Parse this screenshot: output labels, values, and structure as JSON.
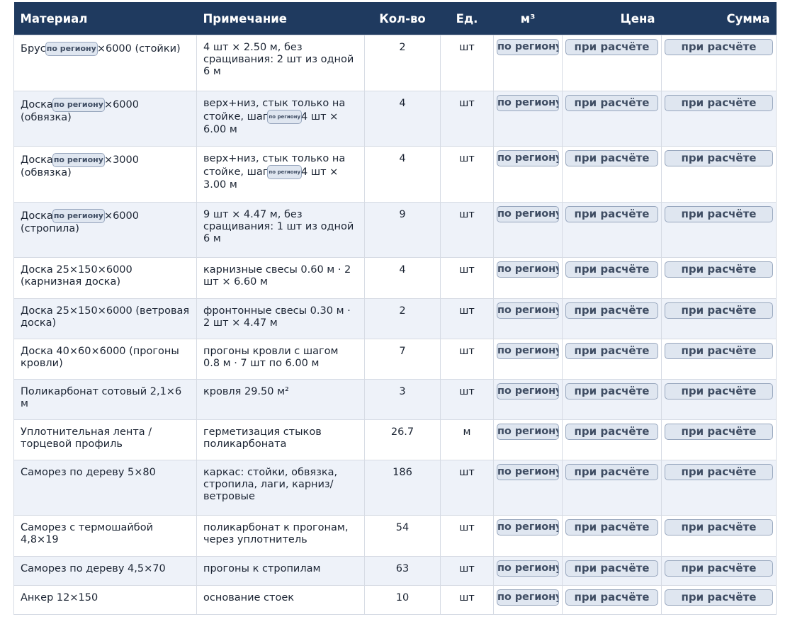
{
  "headers": {
    "material": "Материал",
    "note": "Примечание",
    "qty": "Кол-во",
    "unit": "Ед.",
    "m3": "м³",
    "price": "Цена",
    "sum": "Сумма"
  },
  "placeholders": {
    "region": "по региону",
    "calc": "при расчёте"
  },
  "rows": [
    {
      "mat_a": "Брус",
      "mat_b": "×6000 (стойки)",
      "note": "4 шт × 2.50 м, без сращивания: 2 шт из одной 6 м",
      "qty": "2",
      "unit": "шт"
    },
    {
      "mat_a": "Доска",
      "mat_b": "×6000 (обвязка)",
      "note_a": "верх+низ, стык только на стойке, шаг",
      "note_b": "4 шт × 6.00 м",
      "qty": "4",
      "unit": "шт"
    },
    {
      "mat_a": "Доска",
      "mat_b": "×3000 (обвязка)",
      "note_a": "верх+низ, стык только на стойке, шаг",
      "note_b": "4 шт × 3.00 м",
      "qty": "4",
      "unit": "шт"
    },
    {
      "mat_a": "Доска",
      "mat_b": "×6000 (стропила)",
      "note": "9 шт × 4.47 м, без сращивания: 1 шт из одной 6 м",
      "qty": "9",
      "unit": "шт"
    },
    {
      "mat": "Доска 25×150×6000 (карнизная доска)",
      "note": "карнизные свесы 0.60 м · 2 шт × 6.60 м",
      "qty": "4",
      "unit": "шт"
    },
    {
      "mat": "Доска 25×150×6000 (ветровая доска)",
      "note": "фронтонные свесы 0.30 м · 2 шт × 4.47 м",
      "qty": "2",
      "unit": "шт"
    },
    {
      "mat": "Доска 40×60×6000 (прогоны кровли)",
      "note": "прогоны кровли с шагом 0.8 м · 7 шт по 6.00 м",
      "qty": "7",
      "unit": "шт"
    },
    {
      "mat": "Поликарбонат сотовый 2,1×6 м",
      "note": "кровля 29.50 м²",
      "qty": "3",
      "unit": "шт"
    },
    {
      "mat": "Уплотнительная лента / торцевой профиль",
      "note": "герметизация стыков поликарбоната",
      "qty": "26.7",
      "unit": "м"
    },
    {
      "mat": "Саморез по дереву 5×80",
      "note": "каркас: стойки, обвязка, стропила, лаги, карниз/ветровые",
      "qty": "186",
      "unit": "шт"
    },
    {
      "mat": "Саморез с термошайбой 4,8×19",
      "note": "поликарбонат к прогонам, через уплотнитель",
      "qty": "54",
      "unit": "шт"
    },
    {
      "mat": "Саморез по дереву 4,5×70",
      "note": "прогоны к стропилам",
      "qty": "63",
      "unit": "шт"
    },
    {
      "mat": "Анкер 12×150",
      "note": "основание стоек",
      "qty": "10",
      "unit": "шт"
    }
  ]
}
